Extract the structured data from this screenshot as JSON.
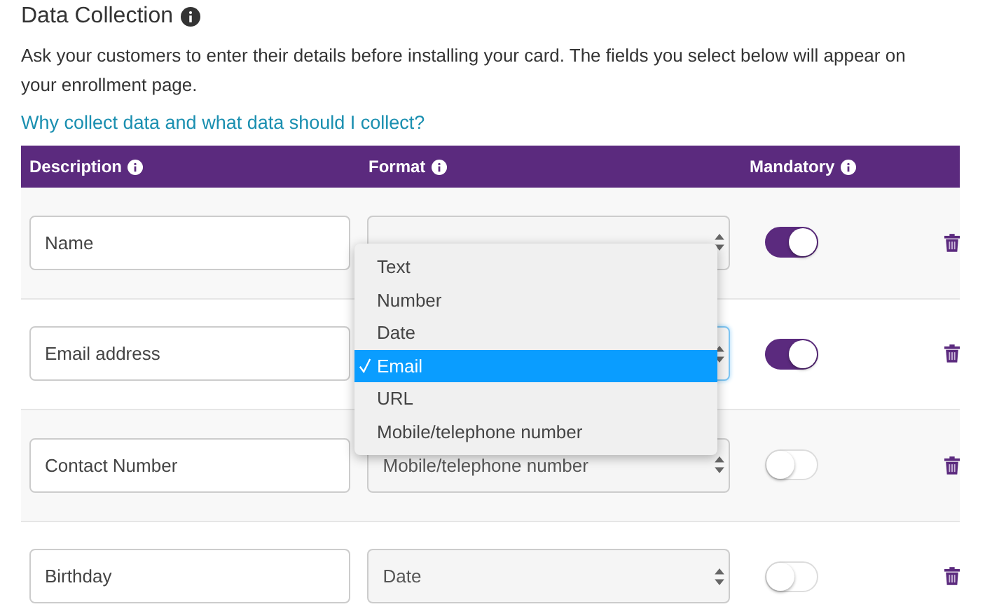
{
  "section": {
    "title": "Data Collection",
    "description": "Ask your customers to enter their details before installing your card. The fields you select below will appear on your enrollment page.",
    "link": "Why collect data and what data should I collect?"
  },
  "table": {
    "columns": [
      {
        "label": "Description"
      },
      {
        "label": "Format"
      },
      {
        "label": "Mandatory"
      }
    ],
    "rows": [
      {
        "description": "Name",
        "focused": false,
        "mandatory": true
      },
      {
        "description": "Email address",
        "focused": true,
        "mandatory": true
      },
      {
        "description": "Contact Number",
        "format": "Mobile/telephone number",
        "focused": false,
        "mandatory": false
      },
      {
        "description": "Birthday",
        "format": "Date",
        "focused": false,
        "mandatory": false
      }
    ]
  },
  "dropdown": {
    "options": [
      {
        "label": "Text",
        "selected": false
      },
      {
        "label": "Number",
        "selected": false
      },
      {
        "label": "Date",
        "selected": false
      },
      {
        "label": "Email",
        "selected": true
      },
      {
        "label": "URL",
        "selected": false
      },
      {
        "label": "Mobile/telephone number",
        "selected": false
      }
    ]
  }
}
